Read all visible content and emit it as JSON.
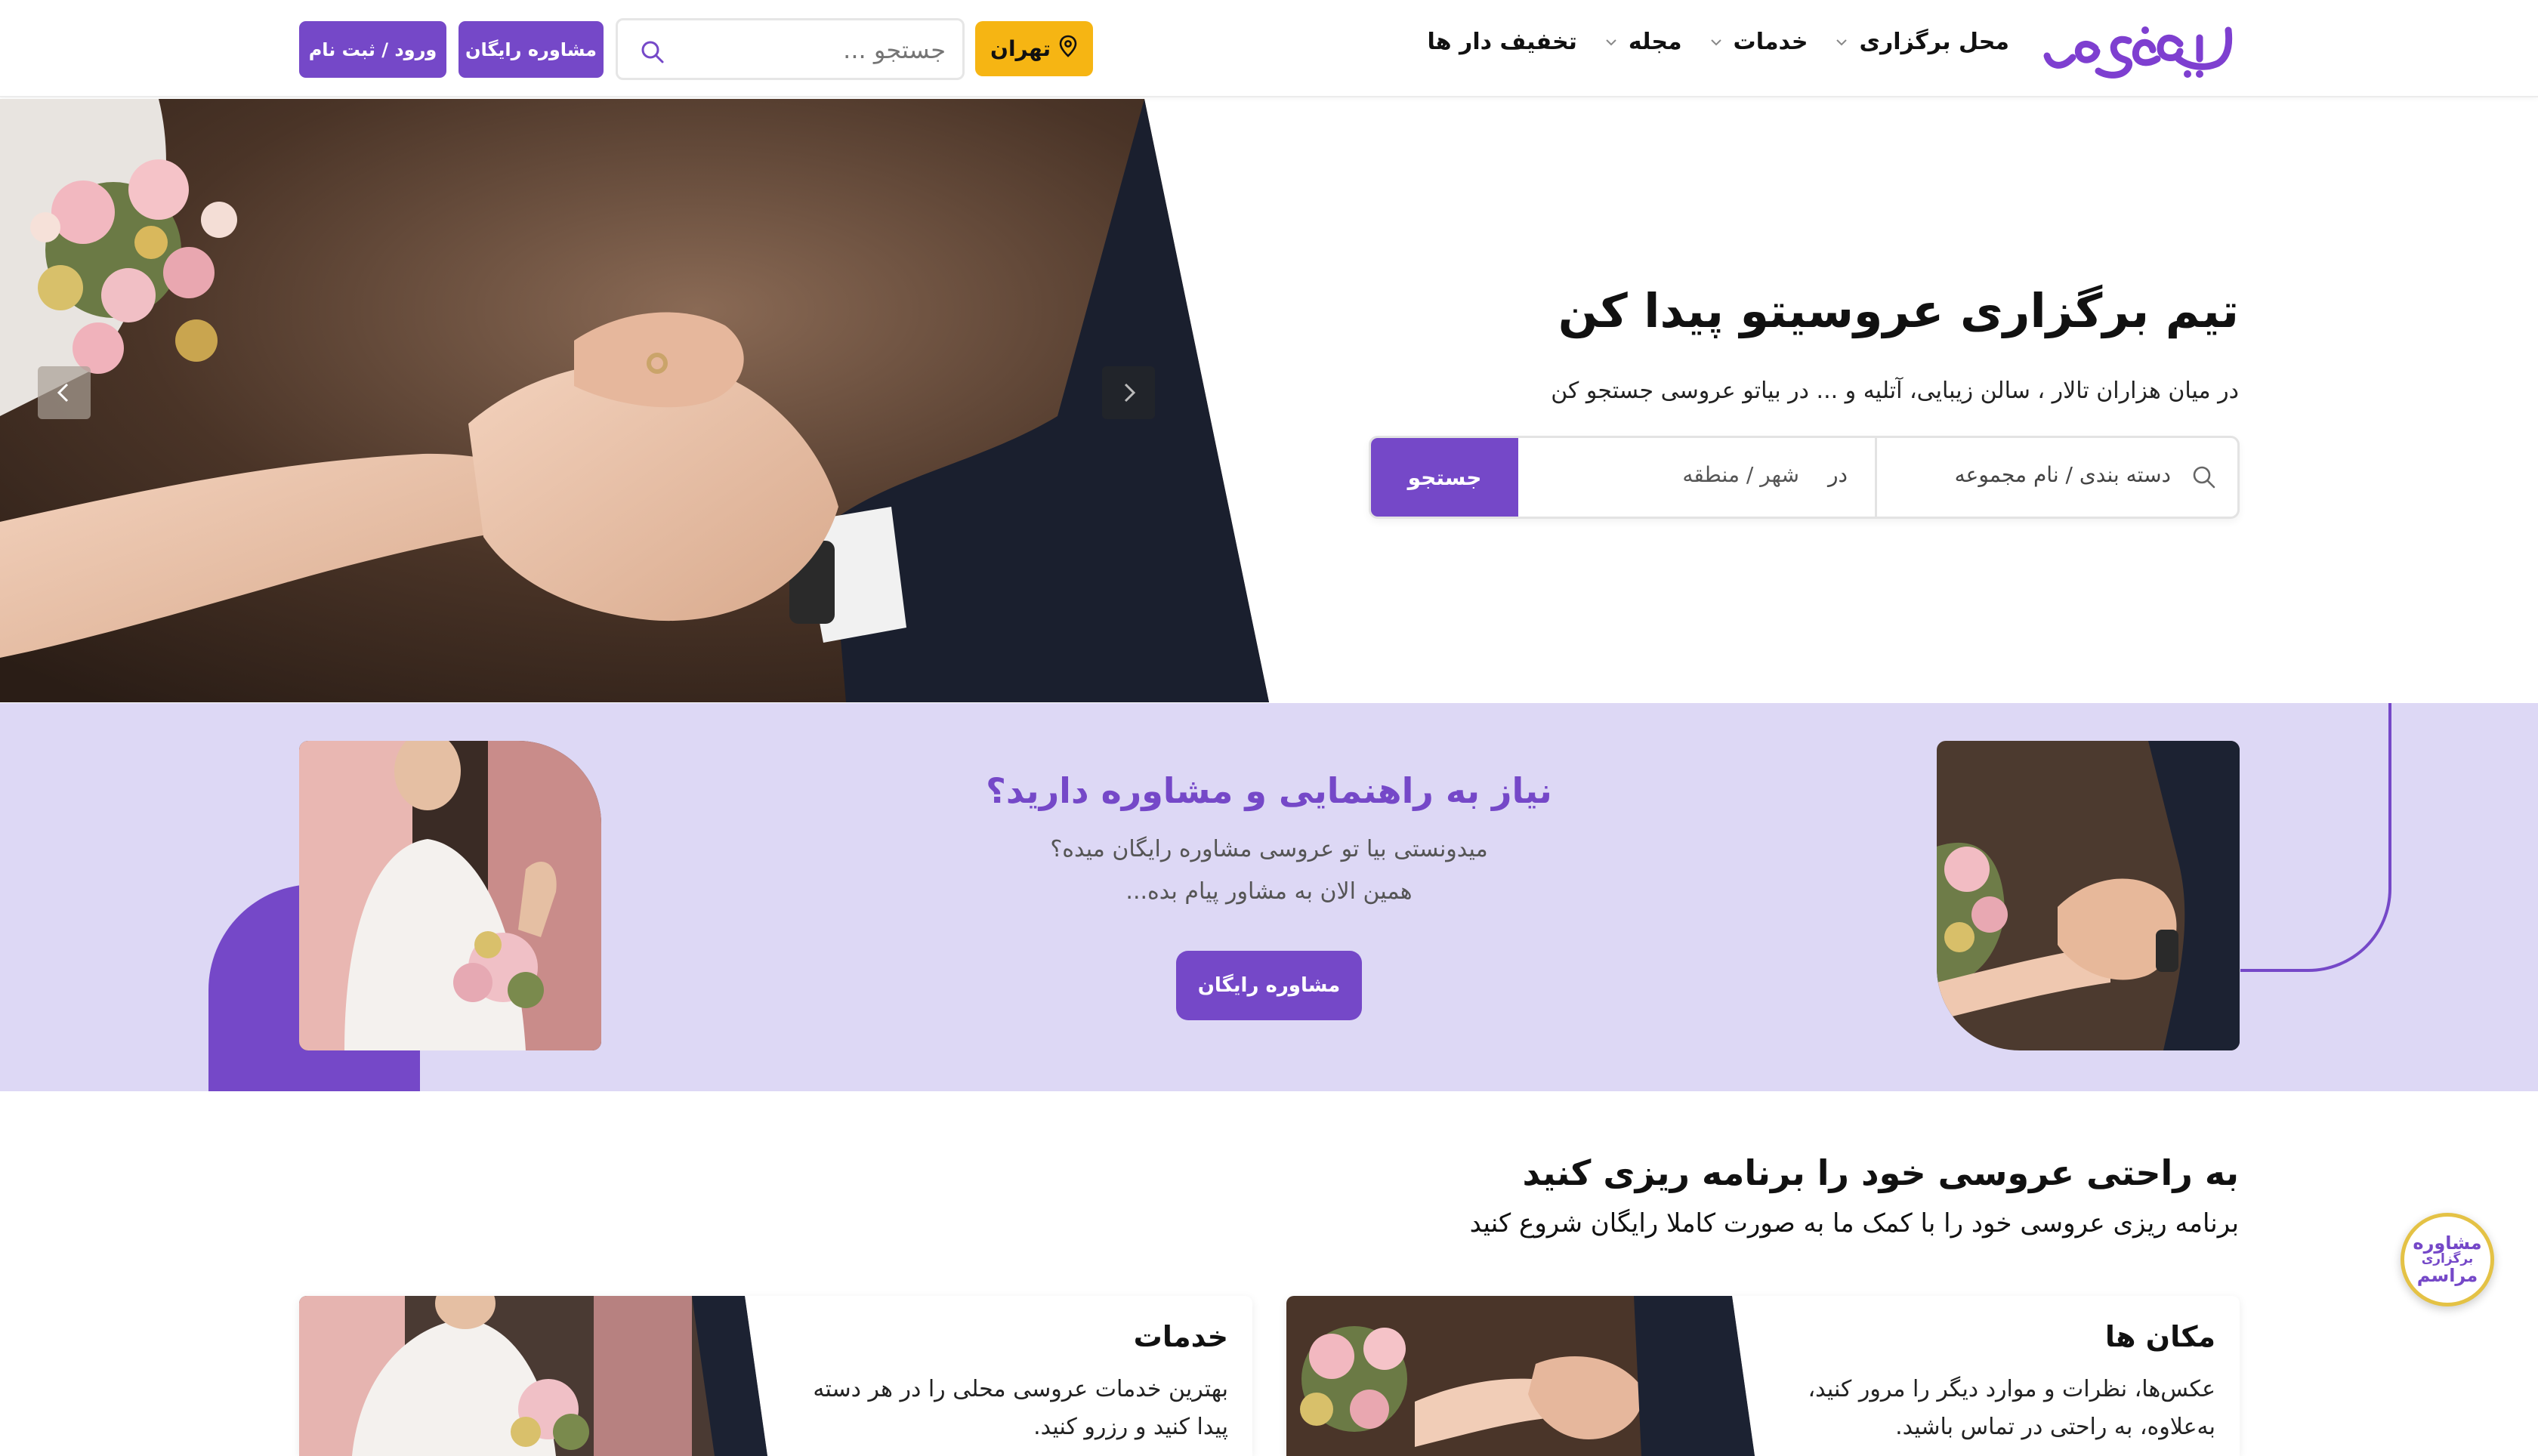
{
  "brand": {
    "logo_text": "بیاتوعروسی",
    "accent": "#7548c8",
    "yellow": "#f6b513",
    "band_bg": "#ddd8f5"
  },
  "nav": {
    "items": [
      {
        "label": "محل برگزاری",
        "has_dropdown": true
      },
      {
        "label": "خدمات",
        "has_dropdown": true
      },
      {
        "label": "مجله",
        "has_dropdown": true
      },
      {
        "label": "تخفیف دار ها",
        "has_dropdown": false
      }
    ]
  },
  "header": {
    "city_label": "تهران",
    "search_placeholder": "جستجو ...",
    "consult_label": "مشاوره رایگان",
    "login_label": "ورود / ثبت نام"
  },
  "hero": {
    "title": "تیم برگزاری عروسیتو پیدا کن",
    "subtitle": "در میان هزاران تالار ، سالن زیبایی، آتلیه و ... در بیاتو عروسی جستجو کن",
    "category_placeholder": "دسته بندی / نام مجموعه",
    "in_label": "در",
    "city_placeholder": "شهر / منطقه",
    "search_button": "جستجو"
  },
  "consult": {
    "title": "نیاز به راهنمایی و مشاوره دارید؟",
    "line1": "میدونستی بیا تو عروسی مشاوره رایگان میده؟",
    "line2": "همین الان به مشاور پیام بده...",
    "button": "مشاوره رایگان"
  },
  "planning": {
    "title": "به راحتی عروسی خود را برنامه ریزی کنید",
    "subtitle": "برنامه ریزی عروسی خود را با کمک ما به صورت کاملا رایگان شروع کنید",
    "cards": [
      {
        "title": "مکان ها",
        "line1": "عکس‌ها، نظرات و موارد دیگر را مرور کنید،",
        "line2": "به‌علاوه، به راحتی در تماس باشید."
      },
      {
        "title": "خدمات",
        "line1": "بهترین خدمات عروسی محلی را در هر دسته",
        "line2": "پیدا کنید و رزرو کنید."
      }
    ]
  },
  "float_badge": {
    "line1": "مشاوره",
    "line2": "برگزاری",
    "line3": "مراسم"
  }
}
